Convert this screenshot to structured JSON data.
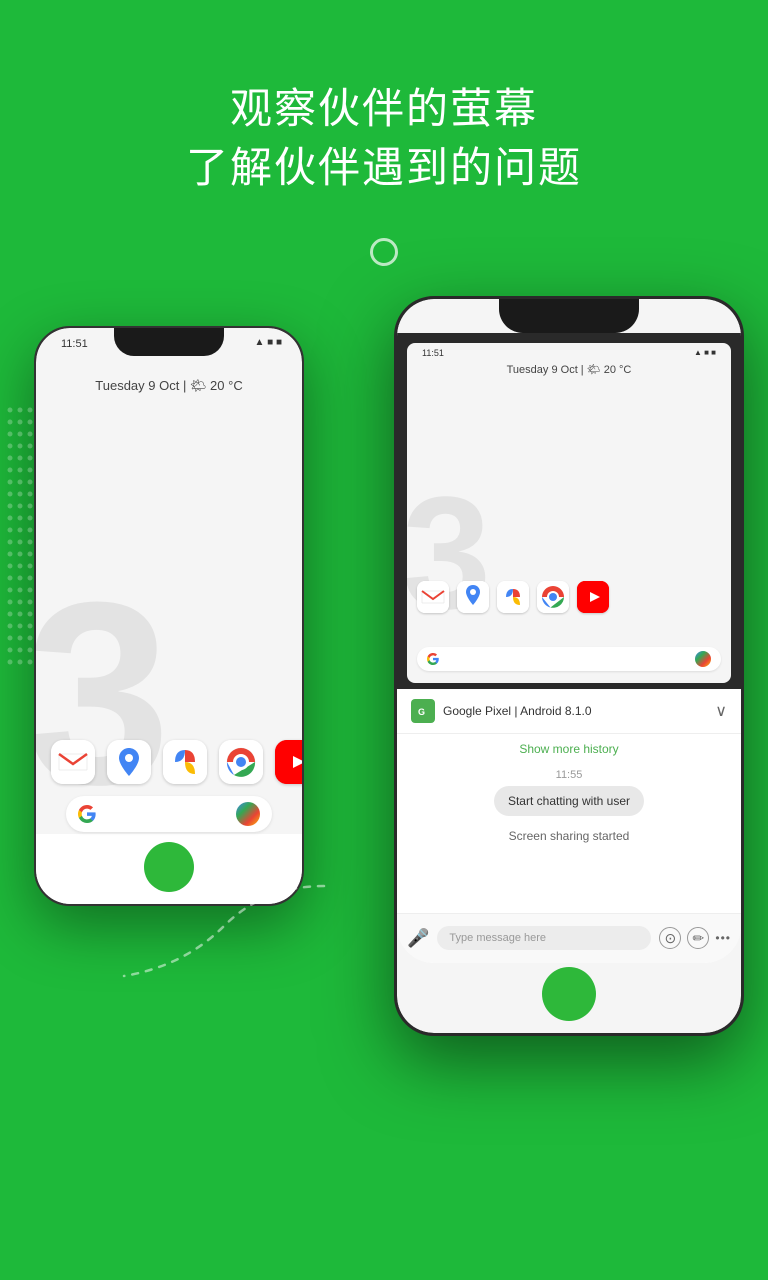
{
  "page": {
    "background_color": "#1EB93A",
    "title_line1": "观察伙伴的萤幕",
    "title_line2": "了解伙伴遇到的问题"
  },
  "phone_left": {
    "time": "11:51",
    "date": "Tuesday 9 Oct | 🌤 20 °C",
    "big_number": "3",
    "apps": [
      "M",
      "📍",
      "🌀",
      "🌐",
      "▶"
    ],
    "search_placeholder": "G"
  },
  "phone_right": {
    "time": "11:51",
    "date": "Tuesday 9 Oct | 🌤 20 °C",
    "big_number": "3",
    "device_label": "Google Pixel | Android 8.1.0",
    "chat": {
      "show_history": "Show more history",
      "timestamp": "11:55",
      "bubble_text": "Start chatting with user",
      "screen_sharing_text": "Screen sharing started",
      "input_placeholder": "Type message here"
    }
  },
  "icons": {
    "expand": "∨",
    "mic": "🎤",
    "headphones": "⊙",
    "pen": "✏",
    "more": "···"
  }
}
